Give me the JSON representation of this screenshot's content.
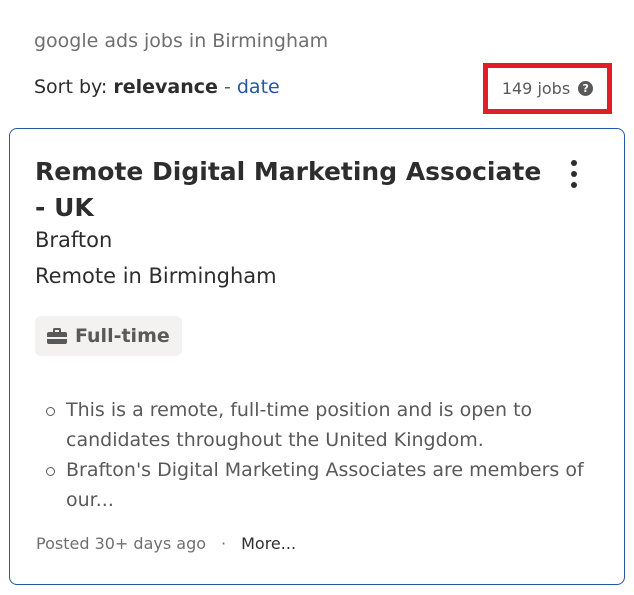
{
  "search": {
    "title": "google ads jobs in Birmingham"
  },
  "sort": {
    "prefix": "Sort by:",
    "active": "relevance",
    "separator": "-",
    "alternative": "date"
  },
  "results": {
    "count_label": "149 jobs",
    "help_icon": "?"
  },
  "job": {
    "title": "Remote Digital Marketing Associate - UK",
    "company": "Brafton",
    "location": "Remote in Birmingham",
    "job_type": "Full-time",
    "job_type_icon": "briefcase-icon",
    "snippet": [
      "This is a remote, full-time position and is open to candidates throughout the United Kingdom.",
      "Brafton's Digital Marketing Associates are members of our..."
    ],
    "posted": "Posted 30+ days ago",
    "footer_separator": "·",
    "more_label": "More..."
  },
  "colors": {
    "link": "#2557a7",
    "card_border": "#2557a7",
    "highlight_box": "#e01e26",
    "badge_bg": "#f3f2f1"
  }
}
